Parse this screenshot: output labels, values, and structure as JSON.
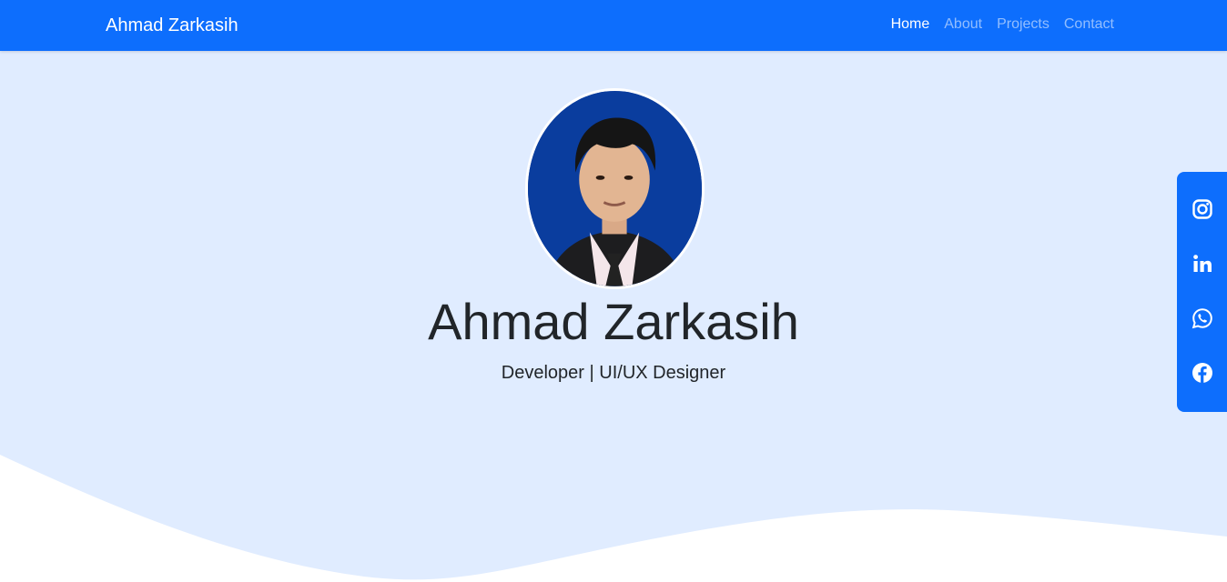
{
  "navbar": {
    "brand": "Ahmad Zarkasih",
    "links": [
      {
        "label": "Home",
        "active": true
      },
      {
        "label": "About",
        "active": false
      },
      {
        "label": "Projects",
        "active": false
      },
      {
        "label": "Contact",
        "active": false
      }
    ]
  },
  "hero": {
    "name": "Ahmad Zarkasih",
    "role": "Developer | UI/UX Designer",
    "avatar_icon": "profile-photo"
  },
  "social": {
    "icons": [
      "instagram-icon",
      "linkedin-icon",
      "whatsapp-icon",
      "facebook-icon"
    ]
  },
  "colors": {
    "primary": "#0d6efd",
    "hero_bg": "#e0ecff",
    "text": "#212529",
    "white": "#ffffff"
  }
}
